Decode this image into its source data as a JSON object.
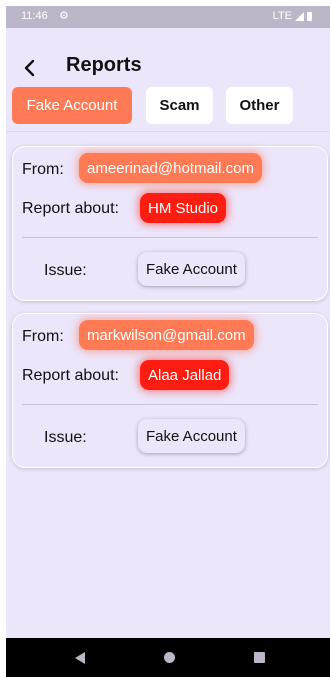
{
  "status_bar": {
    "time": "11:46",
    "network": "LTE"
  },
  "app_bar": {
    "title": "Reports"
  },
  "filters": [
    {
      "label": "Fake Account",
      "active": true
    },
    {
      "label": "Scam",
      "active": false
    },
    {
      "label": "Other",
      "active": false
    }
  ],
  "reports": [
    {
      "from_label": "From:",
      "from_email": "ameerinad@hotmail.com",
      "about_label": "Report about:",
      "about_name": "HM Studio",
      "issue_label": "Issue:",
      "issue_value": "Fake Account"
    },
    {
      "from_label": "From:",
      "from_email": "markwilson@gmail.com",
      "about_label": "Report about:",
      "about_name": "Alaa Jallad",
      "issue_label": "Issue:",
      "issue_value": "Fake Account"
    }
  ],
  "colors": {
    "accent": "#ff7a55",
    "alert": "#ff1d12",
    "background": "#ece6fb"
  },
  "icons": {
    "status": [
      "gear-icon",
      "signal-icon",
      "battery-icon"
    ],
    "app_bar": "back-arrow-icon",
    "nav": [
      "nav-back-icon",
      "nav-home-icon",
      "nav-recents-icon"
    ]
  }
}
